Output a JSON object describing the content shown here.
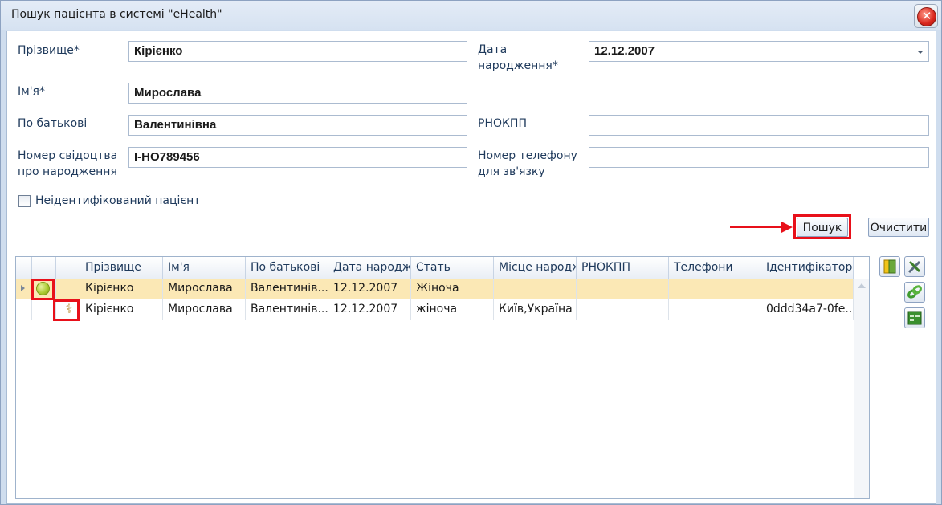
{
  "window": {
    "title": "Пошук пацієнта в системі \"eHealth\"",
    "close_glyph": "✕"
  },
  "form": {
    "surname_label": "Прізвище*",
    "surname_value": "Кірієнко",
    "name_label": "Ім'я*",
    "name_value": "Мирослава",
    "patronymic_label": "По батькові",
    "patronymic_value": "Валентинівна",
    "birth_cert_label_1": "Номер свідоцтва",
    "birth_cert_label_2": "про народження",
    "birth_cert_value": "І-НО789456",
    "dob_label_1": "Дата",
    "dob_label_2": "народження*",
    "dob_value": "12.12.2007",
    "rnokpp_label": "РНОКПП",
    "rnokpp_value": "",
    "phone_label_1": "Номер телефону",
    "phone_label_2": "для зв'язку",
    "phone_value": "",
    "unidentified_label": "Неідентифікований пацієнт",
    "unidentified_checked": false
  },
  "buttons": {
    "search": "Пошук",
    "clear": "Очистити"
  },
  "grid": {
    "columns": [
      "Прізвище",
      "Ім'я",
      "По батькові",
      "Дата народже",
      "Стать",
      "Місце народж",
      "РНОКПП",
      "Телефони",
      "Ідентифікатор в"
    ],
    "rows": [
      {
        "status_icon": "green-circle-icon",
        "surname": "Кірієнко",
        "name": "Мирослава",
        "patronymic": "Валентинів...",
        "dob": "12.12.2007",
        "sex": "Жіноча",
        "birthplace": "",
        "rnokpp": "",
        "phones": "",
        "id": "",
        "selected": true
      },
      {
        "status_icon": "caduceus-icon",
        "surname": "Кірієнко",
        "name": "Мирослава",
        "patronymic": "Валентинів...",
        "dob": "12.12.2007",
        "sex": "жіноча",
        "birthplace": "Київ,Україна",
        "rnokpp": "",
        "phones": "",
        "id": "0ddd34a7-0fe...",
        "selected": false
      }
    ]
  },
  "side_toolbar": [
    "book-icon",
    "tools-icon",
    "link-icon",
    "table-export-icon"
  ],
  "colors": {
    "highlight": "#e8101a",
    "selected_row": "#fbe8b5"
  }
}
